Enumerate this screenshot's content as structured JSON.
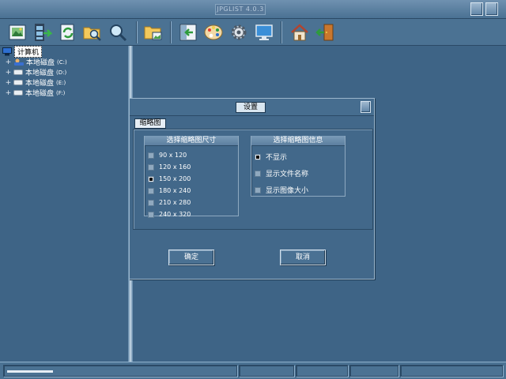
{
  "window": {
    "title": "JPGLIST 4.0.3"
  },
  "toolbar": {
    "buttons": [
      {
        "icon": "image-icon"
      },
      {
        "icon": "filmstrip-icon"
      },
      {
        "icon": "refresh-icon"
      },
      {
        "icon": "folder-search-icon"
      },
      {
        "icon": "magnifier-icon"
      },
      {
        "icon": "folder-image-icon"
      },
      {
        "icon": "panel-arrow-icon"
      },
      {
        "icon": "palette-icon"
      },
      {
        "icon": "gear-icon"
      },
      {
        "icon": "monitor-icon"
      },
      {
        "icon": "home-icon"
      },
      {
        "icon": "exit-door-icon"
      }
    ]
  },
  "tree": {
    "root_label": "计算机",
    "drives": [
      {
        "label": "本地磁盘",
        "letter": "(C:)"
      },
      {
        "label": "本地磁盘",
        "letter": "(D:)"
      },
      {
        "label": "本地磁盘",
        "letter": "(E:)"
      },
      {
        "label": "本地磁盘",
        "letter": "(F:)"
      }
    ]
  },
  "dialog": {
    "title": "设置",
    "tab_label": "缩略图",
    "size_group": {
      "title": "选择缩略图尺寸",
      "options": [
        {
          "label": "90 x 120",
          "checked": false
        },
        {
          "label": "120 x 160",
          "checked": false
        },
        {
          "label": "150 x 200",
          "checked": true
        },
        {
          "label": "180 x 240",
          "checked": false
        },
        {
          "label": "210 x 280",
          "checked": false
        },
        {
          "label": "240 x 320",
          "checked": false
        }
      ]
    },
    "info_group": {
      "title": "选择缩略图信息",
      "options": [
        {
          "label": "不显示",
          "checked": true
        },
        {
          "label": "显示文件名称",
          "checked": false
        },
        {
          "label": "显示图像大小",
          "checked": false
        }
      ]
    },
    "ok_label": "确定",
    "cancel_label": "取消"
  },
  "statusbar": {
    "progress": 0.2
  },
  "colors": {
    "background": "#3e6486",
    "chrome": "#4b7293",
    "accent_light": "#c9dae8"
  }
}
